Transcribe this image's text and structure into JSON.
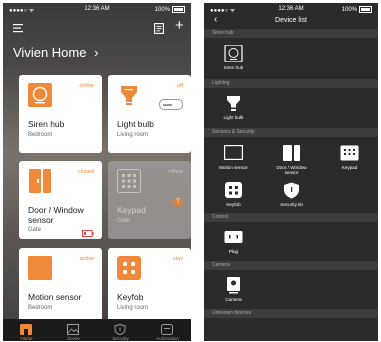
{
  "left": {
    "status": {
      "carrier": "●●●●○ ᯤ",
      "time": "12:36 AM",
      "battery": "100%"
    },
    "home_title": "Vivien Home",
    "home_chevron": "›",
    "menu_icon": "menu-icon",
    "add_icon": "+",
    "cards": [
      {
        "name": "Siren hub",
        "room": "Bedroom",
        "status": "online"
      },
      {
        "name": "Light bulb",
        "room": "Living room",
        "status": "off"
      },
      {
        "name": "Door / Window sensor",
        "room": "Gate",
        "status": "closed"
      },
      {
        "name": "Keypad",
        "room": "Gate",
        "status": "offline"
      },
      {
        "name": "Motion sensor",
        "room": "Bedroom",
        "status": "active"
      },
      {
        "name": "Keyfob",
        "room": "Living room",
        "status": "stay"
      }
    ],
    "tabs": [
      {
        "label": "Home"
      },
      {
        "label": "Scene"
      },
      {
        "label": "Security"
      },
      {
        "label": "Automation"
      }
    ],
    "accent": "#f0893a"
  },
  "right": {
    "status": {
      "carrier": "●●●●○ ᯤ",
      "time": "12:36 AM",
      "battery": "100%"
    },
    "title": "Device list",
    "back": "‹",
    "sections": {
      "siren": "Siren hub",
      "lighting": "Lighting",
      "sensors": "Sensors & Security",
      "control": "Control",
      "camera": "Camera",
      "unknown": "Unknown devices"
    },
    "devices": {
      "siren_hub": "Siren hub",
      "light_bulb": "Light bulb",
      "motion_sensor": "Motion sensor",
      "door_window": "Door / Window sensor",
      "keypad": "Keypad",
      "keyfob": "Keyfob",
      "security_kit": "Security kit",
      "plug": "Plug",
      "camera": "Camera"
    }
  }
}
